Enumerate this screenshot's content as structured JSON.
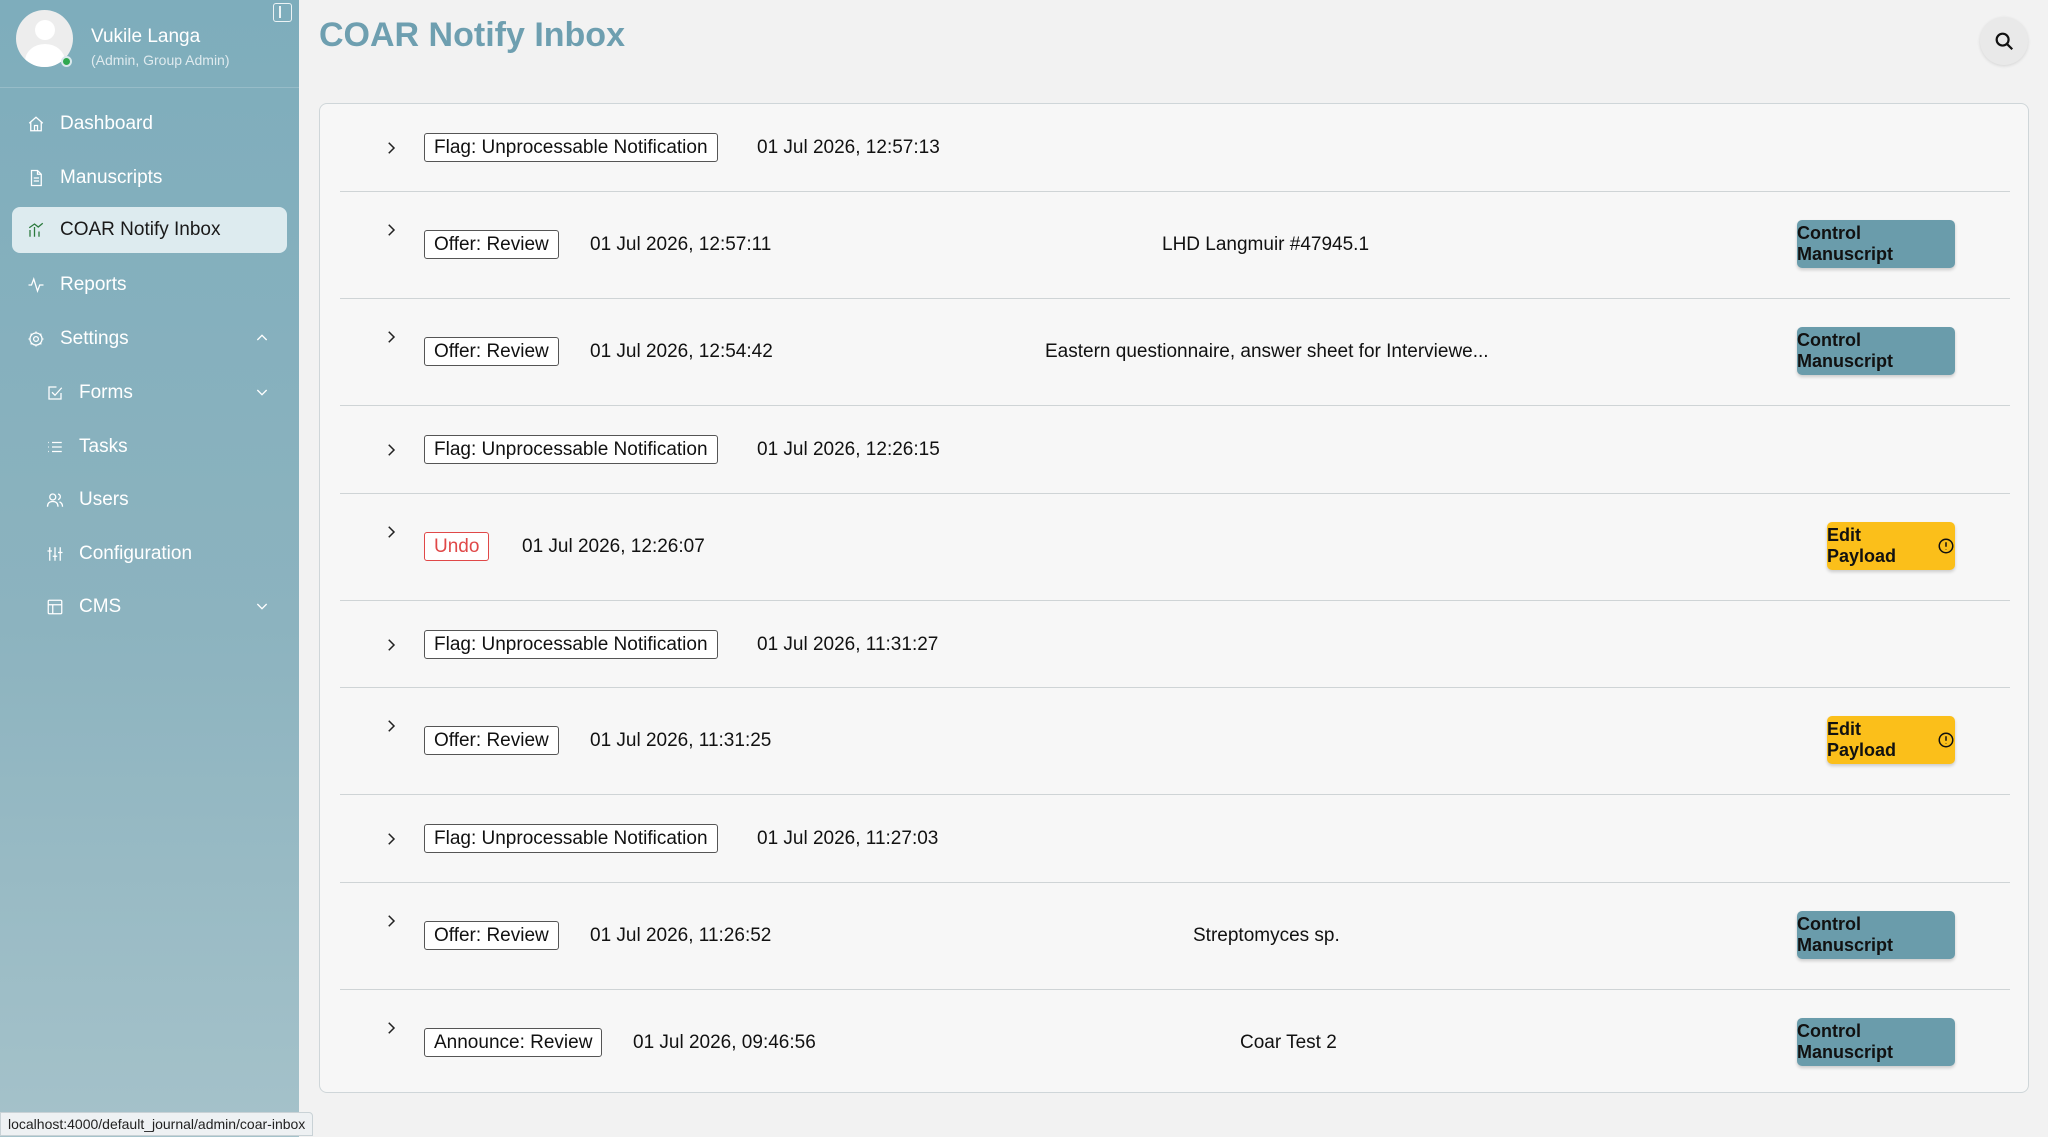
{
  "user": {
    "name": "Vukile Langa",
    "role": "(Admin, Group Admin)"
  },
  "sidebar": {
    "items": [
      {
        "label": "Dashboard",
        "icon": "home-icon"
      },
      {
        "label": "Manuscripts",
        "icon": "document-icon"
      },
      {
        "label": "COAR Notify Inbox",
        "icon": "inbox-chart-icon",
        "active": true
      },
      {
        "label": "Reports",
        "icon": "activity-icon"
      },
      {
        "label": "Settings",
        "icon": "gear-icon",
        "expanded": true
      },
      {
        "label": "Forms",
        "icon": "form-check-icon"
      },
      {
        "label": "Tasks",
        "icon": "list-icon"
      },
      {
        "label": "Users",
        "icon": "users-icon"
      },
      {
        "label": "Configuration",
        "icon": "sliders-icon"
      },
      {
        "label": "CMS",
        "icon": "layout-icon"
      }
    ]
  },
  "page": {
    "title": "COAR Notify Inbox"
  },
  "notifications": [
    {
      "type": "Flag: Unprocessable Notification",
      "timestamp": "01 Jul 2026, 12:57:13",
      "title": "",
      "action": ""
    },
    {
      "type": "Offer: Review",
      "timestamp": "01 Jul 2026, 12:57:11",
      "title": "LHD Langmuir #47945.1",
      "action": "Control Manuscript"
    },
    {
      "type": "Offer: Review",
      "timestamp": "01 Jul 2026, 12:54:42",
      "title": "Eastern questionnaire, answer sheet for Interviewe...",
      "action": "Control Manuscript"
    },
    {
      "type": "Flag: Unprocessable Notification",
      "timestamp": "01 Jul 2026, 12:26:15",
      "title": "",
      "action": ""
    },
    {
      "type": "Undo",
      "timestamp": "01 Jul 2026, 12:26:07",
      "title": "",
      "action": "Edit Payload"
    },
    {
      "type": "Flag: Unprocessable Notification",
      "timestamp": "01 Jul 2026, 11:31:27",
      "title": "",
      "action": ""
    },
    {
      "type": "Offer: Review",
      "timestamp": "01 Jul 2026, 11:31:25",
      "title": "",
      "action": "Edit Payload"
    },
    {
      "type": "Flag: Unprocessable Notification",
      "timestamp": "01 Jul 2026, 11:27:03",
      "title": "",
      "action": ""
    },
    {
      "type": "Offer: Review",
      "timestamp": "01 Jul 2026, 11:26:52",
      "title": "Streptomyces sp.",
      "action": "Control Manuscript"
    },
    {
      "type": "Announce: Review",
      "timestamp": "01 Jul 2026, 09:46:56",
      "title": "Coar Test 2",
      "action": "Control Manuscript"
    }
  ],
  "status_bar": {
    "url": "localhost:4000/default_journal/admin/coar-inbox"
  },
  "colors": {
    "sidebar": "#7eadbc",
    "title": "#6e9fb0",
    "control_button": "#6a9cab",
    "edit_button": "#fbbf1a",
    "undo_tag": "#e04848"
  }
}
